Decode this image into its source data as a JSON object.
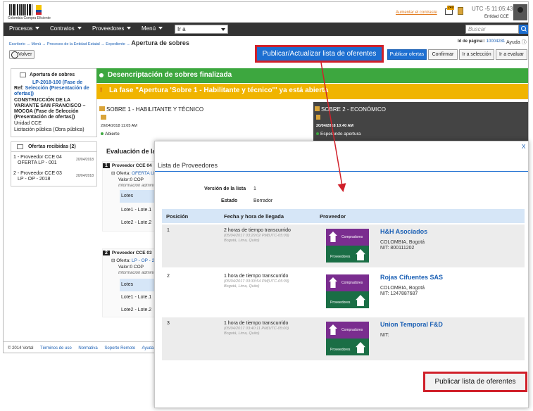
{
  "header": {
    "logo_text": "Colombia Compra Eficiente",
    "link_contract": "Aumentar el contraste",
    "mail_badge": "249",
    "time": "UTC -5 11:05:43",
    "entity": "Entidad CCE"
  },
  "nav": {
    "items": [
      "Procesos",
      "Contratos",
      "Proveedores",
      "Menú"
    ],
    "goto_value": "Ir a",
    "search_placeholder": "Buscar"
  },
  "breadcrumb": {
    "items": [
      "Escritorio",
      "Menú",
      "Procesos de la Entidad Estatal",
      "Expediente"
    ],
    "sep": "→",
    "current": "Apertura de sobres"
  },
  "page_id": {
    "label": "Id de página::",
    "value": "10004281",
    "help": "Ayuda"
  },
  "toolbar": {
    "back": "Volver",
    "highlight": "Publicar/Actualizar lista de oferentes",
    "publish_offers": "Publicar ofertas",
    "confirm": "Confirmar",
    "goto_selection": "Ir a selección",
    "goto_evaluate": "Ir a evaluar"
  },
  "left_panel": {
    "title": "Apertura de sobres",
    "ref_code": "LP-2018-100 (Fase de",
    "ref_label": "Ref:",
    "ref_phase": "Selección (Presentación de ofertas))",
    "desc1": "CONSTRUCCIÓN DE LA",
    "desc2": "VARIANTE SAN FRANCISCO –",
    "desc3": "MOCOA (Fase de Selección",
    "desc4": "(Presentación de ofertas))",
    "unit": "Unidad CCE",
    "type": "Licitación pública (Obra pública)"
  },
  "offers": {
    "title": "Ofertas recibidas (2)",
    "items": [
      {
        "line1": "1 - Proveedor CCE 04",
        "line2": "OFERTA LP - 001",
        "date": "20/04/2018"
      },
      {
        "line1": "2 - Proveedor CCE 03",
        "line2": "LP - OP - 2018",
        "date": "20/04/2018"
      }
    ]
  },
  "status": {
    "green": "Desencriptación de sobres finalizada",
    "yellow": "La fase \"Apertura 'Sobre 1 - Habilitante y técnico'\" ya está abierta"
  },
  "sobres": [
    {
      "title": "SOBRE 1 - HABILITANTE Y TÉCNICO",
      "date": "20/04/2018 11:05 AM",
      "state": "Abierto"
    },
    {
      "title": "SOBRE 2 - ECONÓMICO",
      "date": "20/04/2018 10:40 AM",
      "state": "Esperando apertura"
    }
  ],
  "evaluation": {
    "title": "Evaluación de la d",
    "cards": [
      {
        "num": "1",
        "name": "Proveedor CCE 04",
        "offer_label": "Oferta:",
        "offer": "OFERTA LP",
        "value": "Valor:0 COP",
        "info": "Información admini",
        "lots_header": "Lotes",
        "lots": [
          "Lote1 - Lote.1",
          "Lote2 - Lote.2"
        ]
      },
      {
        "num": "2",
        "name": "Proveedor CCE 03",
        "offer_label": "Oferta:",
        "offer": "LP - OP - 2",
        "value": "Valor:0 COP",
        "info": "Información admini",
        "lots_header": "Lotes",
        "lots": [
          "Lote1 - Lote.1",
          "Lote2 - Lote.2"
        ]
      }
    ]
  },
  "footer": {
    "copyright": "© 2014 Vortal",
    "links": [
      "Términos de uso",
      "Normativa",
      "Soporte Remoto",
      "Ayuda"
    ]
  },
  "modal": {
    "close": "X",
    "title": "Lista de Proveedores",
    "version_label": "Versión de la lista",
    "version_value": "1",
    "state_label": "Estado",
    "state_value": "Borrador",
    "columns": [
      "Posición",
      "Fecha y hora de llegada",
      "Proveedor"
    ],
    "logo_top": "Compradores",
    "logo_bottom": "Proveedores",
    "rows": [
      {
        "pos": "1",
        "time": "2 horas de tiempo transcurrido",
        "stamp": "(05/04/2017 03:29:02 PM(UTC-05:00)",
        "tz": "Bogotá, Lima, Quito)",
        "name": "H&H Asociados",
        "addr1": "COLOMBIA, Bogotá",
        "addr2": "NIT: 800111202"
      },
      {
        "pos": "2",
        "time": "1 hora de tiempo transcurrido",
        "stamp": "(05/04/2017 03:33:54 PM(UTC-05:00)",
        "tz": "Bogotá, Lima, Quito)",
        "name": "Rojas Cifuentes SAS",
        "addr1": "COLOMBIA, Bogotá",
        "addr2": "NIT: 1247887687"
      },
      {
        "pos": "3",
        "time": "1 hora de tiempo transcurrido",
        "stamp": "(05/04/2017 03:40:11 PM(UTC-05:00)",
        "tz": "Bogotá, Lima, Quito)",
        "name": "Union Temporal F&D",
        "addr1": "NIT:",
        "addr2": ""
      }
    ],
    "publish": "Publicar lista de oferentes"
  },
  "colors": {
    "accent": "#1d6fd1",
    "highlight": "#d0202a",
    "green": "#3da73f",
    "yellow": "#f0b400"
  }
}
